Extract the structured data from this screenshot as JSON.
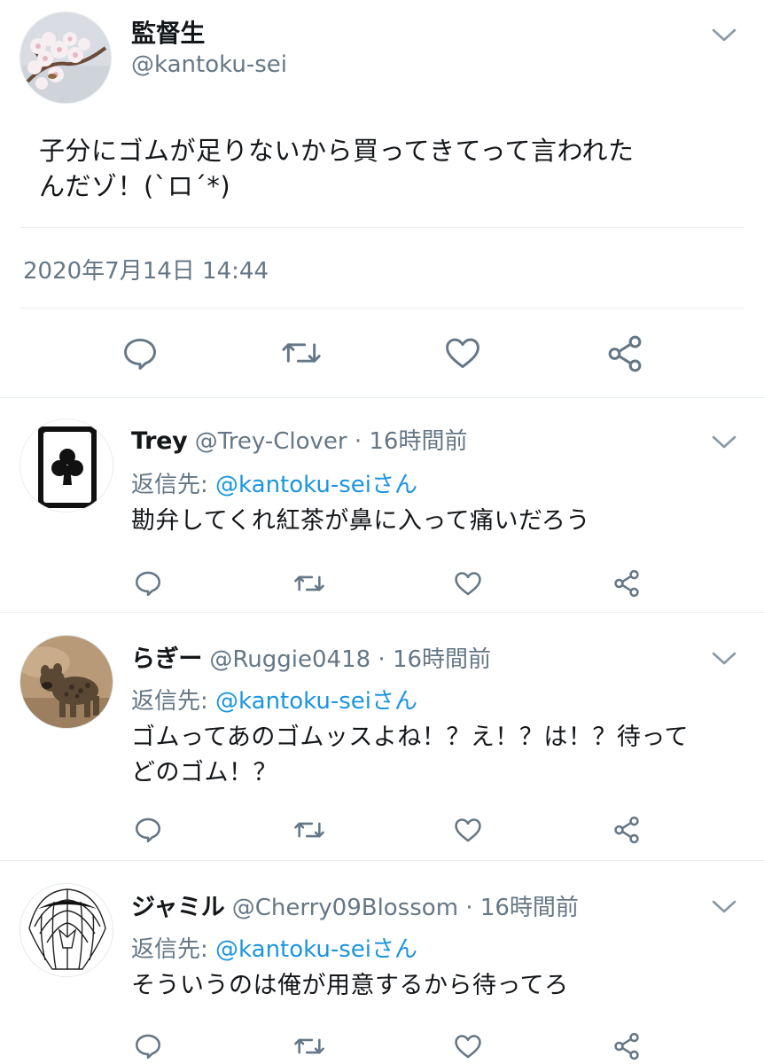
{
  "main_tweet": {
    "display_name": "監督生",
    "handle": "@kantoku-sei",
    "text_line1": "子分にゴムが足りないから買ってきてって言われた",
    "text_line2": "んだゾ！(`ロ´*)",
    "timestamp": "2020年7月14日 14:44"
  },
  "replies": [
    {
      "display_name": "Trey",
      "handle": "@Trey-Clover",
      "time": "· 16時間前",
      "reply_to_prefix": "返信先: ",
      "reply_to_user": "@kantoku-sei",
      "reply_to_suffix": "さん",
      "text_line1": "勘弁してくれ紅茶が鼻に入って痛いだろう",
      "text_line2": ""
    },
    {
      "display_name": "らぎー",
      "handle": "@Ruggie0418",
      "time": "· 16時間前",
      "reply_to_prefix": "返信先: ",
      "reply_to_user": "@kantoku-sei",
      "reply_to_suffix": "さん",
      "text_line1": "ゴムってあのゴムッスよね！？え！？は！？待って",
      "text_line2": "どのゴム！？"
    },
    {
      "display_name": "ジャミル",
      "handle": "@Cherry09Blossom",
      "time": "· 16時間前",
      "reply_to_prefix": "返信先: ",
      "reply_to_user": "@kantoku-sei",
      "reply_to_suffix": "さん",
      "text_line1": "そういうのは俺が用意するから待ってろ",
      "text_line2": ""
    }
  ],
  "icons": {
    "reply": "speech-bubble-icon",
    "retweet": "retweet-icon",
    "like": "heart-icon",
    "share": "share-icon",
    "more": "chevron-down-icon"
  },
  "colors": {
    "text": "#14171a",
    "muted": "#657786",
    "link": "#1b95e0",
    "divider": "#e6ecf0"
  }
}
